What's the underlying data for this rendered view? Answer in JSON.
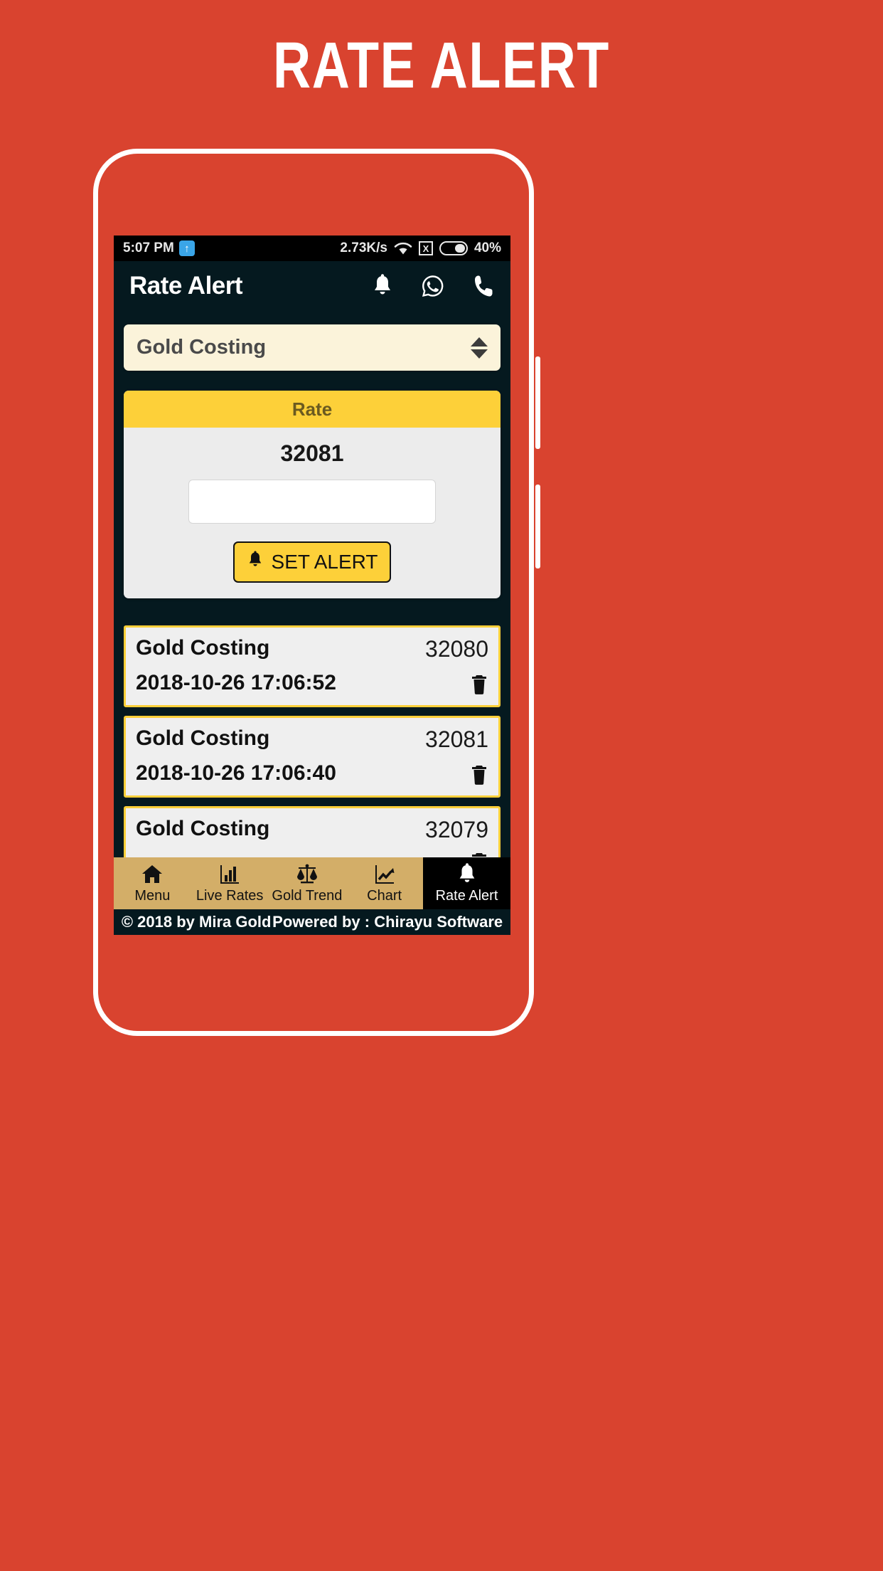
{
  "promo": {
    "title": "RATE ALERT",
    "background_color": "#D9432F"
  },
  "phone": {
    "frame_color": "#FFFFFF",
    "buttons": [
      "volume-rocker",
      "power-button"
    ]
  },
  "status_bar": {
    "time": "5:07 PM",
    "data_indicator_icon": "upload-arrow-icon",
    "network_speed": "2.73K/s",
    "wifi_icon": "wifi-icon",
    "sim_icon": "no-sim-icon",
    "sim_label": "X",
    "battery_icon": "battery-icon",
    "battery_percent": "40%"
  },
  "app_bar": {
    "title": "Rate Alert",
    "actions": [
      {
        "name": "notification-bell",
        "icon": "bell-icon"
      },
      {
        "name": "whatsapp",
        "icon": "whatsapp-icon"
      },
      {
        "name": "call",
        "icon": "phone-icon"
      }
    ]
  },
  "dropdown": {
    "selected": "Gold Costing",
    "options": [
      "Gold Costing"
    ],
    "background_color": "#FBF3DA"
  },
  "rate_card": {
    "header": "Rate",
    "header_color": "#FDD039",
    "value": "32081",
    "input_value": "",
    "input_placeholder": "",
    "button_label": "SET ALERT",
    "button_icon": "bell-icon"
  },
  "alerts": [
    {
      "name": "Gold Costing",
      "value": "32080",
      "timestamp": "2018-10-26 17:06:52",
      "delete_icon": "trash-icon"
    },
    {
      "name": "Gold Costing",
      "value": "32081",
      "timestamp": "2018-10-26 17:06:40",
      "delete_icon": "trash-icon"
    },
    {
      "name": "Gold Costing",
      "value": "32079",
      "timestamp": "",
      "delete_icon": "trash-icon"
    }
  ],
  "bottom_nav": {
    "background_color": "#D3AE68",
    "active_background_color": "#000000",
    "items": [
      {
        "label": "Menu",
        "icon": "home-icon",
        "active": false
      },
      {
        "label": "Live Rates",
        "icon": "bar-chart-icon",
        "active": false
      },
      {
        "label": "Gold Trend",
        "icon": "scales-icon",
        "active": false
      },
      {
        "label": "Chart",
        "icon": "line-chart-icon",
        "active": false
      },
      {
        "label": "Rate Alert",
        "icon": "bell-icon",
        "active": true
      }
    ]
  },
  "footer": {
    "copyright": "© 2018 by Mira Gold",
    "powered_by": "Powered by : Chirayu Software"
  }
}
